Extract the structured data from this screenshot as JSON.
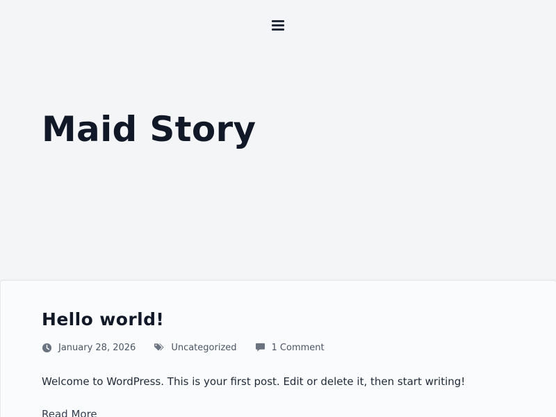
{
  "header": {
    "menu_icon": "hamburger-menu-icon"
  },
  "hero": {
    "site_title": "Maid Story"
  },
  "post": {
    "title": "Hello world!",
    "meta": {
      "date_icon": "clock-icon",
      "date": "January 28, 2026",
      "category_icon": "tags-icon",
      "category": "Uncategorized",
      "comments_icon": "comment-icon",
      "comments": "1 Comment"
    },
    "excerpt": "Welcome to WordPress. This is your first post. Edit or delete it, then start writing!",
    "read_more": "Read More"
  },
  "colors": {
    "background": "#f4f5f7",
    "card_background": "#fafbfc",
    "text_primary": "#111827",
    "text_meta": "#4b5563",
    "icon_meta": "#6b7280"
  }
}
